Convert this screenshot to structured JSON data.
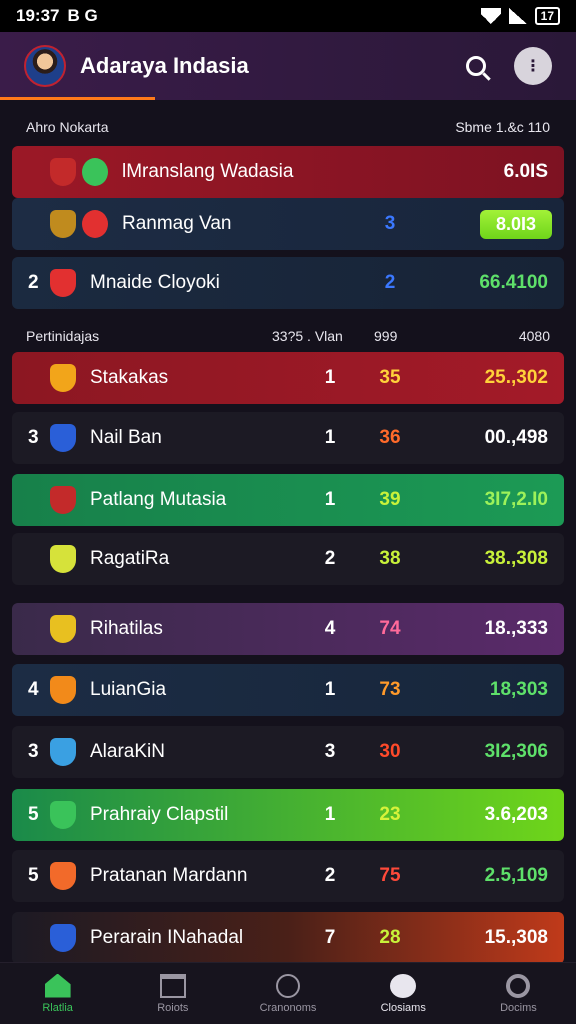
{
  "status": {
    "time": "19:37",
    "extra": "B G",
    "battery": "17"
  },
  "app": {
    "title": "Adaraya Indasia"
  },
  "section1": {
    "left": "Ahro Nokarta",
    "right": "Sbme 1.&c 110",
    "rows": [
      {
        "rank": "",
        "name": "lMranslang Wadasia",
        "a": "",
        "b": "",
        "c": "6.0IS",
        "bg": "linear-gradient(90deg,#9b1826,#7d1222)",
        "bcolor": "#ffffff",
        "ccolor": "#ffffff",
        "badge1": "#c32a2a",
        "badge2": "#3ac35a"
      },
      {
        "rank": "",
        "name": "Ranmag Van",
        "a": "",
        "b": "3",
        "c": "8.0I3",
        "bg": "linear-gradient(90deg,#1d2c44,#18253b)",
        "bcolor": "#3b78ff",
        "ccolor": "#ffffff",
        "pill": true,
        "badge1": "#c08b1e",
        "badge2": "#e23030"
      },
      {
        "rank": "2",
        "name": "Mnaide Cloyoki",
        "a": "",
        "b": "2",
        "c": "66.4100",
        "bg": "linear-gradient(90deg,#1b2a40,#172336)",
        "bcolor": "#3b78ff",
        "ccolor": "#5ee06a",
        "badge1": "#e23030"
      }
    ]
  },
  "section2": {
    "left": "Pertinidajas",
    "mid": "33?5 . Vlan",
    "col": "999",
    "right": "4080",
    "rows": [
      {
        "rank": "",
        "name": "Stakakas",
        "a": "1",
        "b": "35",
        "c": "25.,302",
        "bg": "linear-gradient(90deg,#8c1722,#a31a28)",
        "bcolor": "#ffd23a",
        "ccolor": "#ffd23a",
        "badge1": "#f2a51a"
      },
      {
        "rank": "3",
        "name": "Nail Ban",
        "a": "1",
        "b": "36",
        "c": "00.,498",
        "bg": "#1c1a24",
        "bcolor": "#ff6a2a",
        "ccolor": "#ffffff",
        "badge1": "#2a5fd8"
      },
      {
        "rank": "",
        "name": "Patlang Mutasia",
        "a": "1",
        "b": "39",
        "c": "3I7,2.I0",
        "bg": "linear-gradient(90deg,#17804a,#1c9a55)",
        "bcolor": "#c8f23a",
        "ccolor": "#9df25a",
        "badge1": "#c32a2a"
      },
      {
        "rank": "",
        "name": "RagatiRa",
        "a": "2",
        "b": "38",
        "c": "38.,308",
        "bg": "#1c1a24",
        "bcolor": "#c8f23a",
        "ccolor": "#c8f23a",
        "badge1": "#d6e23a"
      }
    ]
  },
  "section3": {
    "rows": [
      {
        "rank": "",
        "name": "Rihatilas",
        "a": "4",
        "b": "74",
        "c": "18.,333",
        "bg": "linear-gradient(90deg,#3a2a4a,#5a2a6a)",
        "bcolor": "#ff6a9a",
        "ccolor": "#ffffff",
        "badge1": "#e8c020"
      },
      {
        "rank": "4",
        "name": "LuianGia",
        "a": "1",
        "b": "73",
        "c": "18,303",
        "bg": "linear-gradient(90deg,#1c2c44,#17263b)",
        "bcolor": "#ff9a2a",
        "ccolor": "#5ee06a",
        "badge1": "#f28a1a"
      },
      {
        "rank": "3",
        "name": "AlaraKiN",
        "a": "3",
        "b": "30",
        "c": "3I2,306",
        "bg": "#1c1a24",
        "bcolor": "#ff4a2a",
        "ccolor": "#5ee06a",
        "badge1": "#3aa0e2"
      },
      {
        "rank": "5",
        "name": "Prahraiy Clapstil",
        "a": "1",
        "b": "23",
        "c": "3.6,203",
        "bg": "linear-gradient(90deg,#1a8a4a,#6fd51a)",
        "bcolor": "#d6f23a",
        "ccolor": "#ffffff",
        "badge1": "#3ac35a"
      },
      {
        "rank": "5",
        "name": "Pratanan Mardann",
        "a": "2",
        "b": "75",
        "c": "2.5,109",
        "bg": "#1c1a24",
        "bcolor": "#ff4a3a",
        "ccolor": "#5ee06a",
        "badge1": "#f26a2a"
      },
      {
        "rank": "",
        "name": "Perarain INahadal",
        "a": "7",
        "b": "28",
        "c": "15.,308",
        "bg": "linear-gradient(90deg,#1c1a24,#4a2018,#c03a1a)",
        "bcolor": "#c8f23a",
        "ccolor": "#ffffff",
        "badge1": "#2a5fd8"
      }
    ]
  },
  "nav": [
    {
      "label": "Rlatlia",
      "active": true
    },
    {
      "label": "Roiots",
      "active": false
    },
    {
      "label": "Cranonoms",
      "active": false
    },
    {
      "label": "Closiams",
      "active": false
    },
    {
      "label": "Docims",
      "active": false
    }
  ]
}
